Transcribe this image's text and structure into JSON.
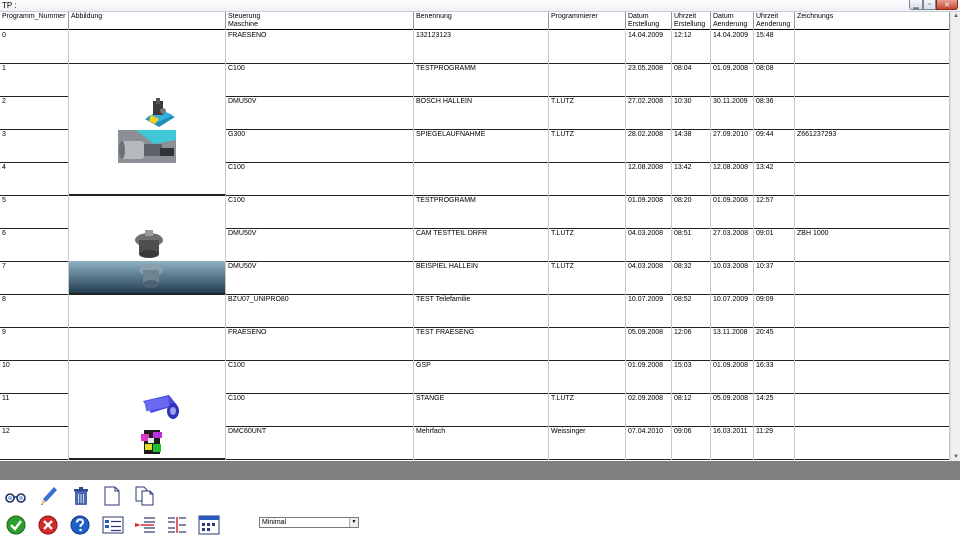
{
  "window": {
    "title": "TP :"
  },
  "columns": [
    "Programm_Nummer",
    "Abbildung",
    "Steuerung\nMaschine",
    "Benennung",
    "Programmierer",
    "Datum\nErstellung",
    "Uhrzeit\nErstellung",
    "Datum\nAenderung",
    "Uhrzeit\nAenderung",
    "Zeichnungs"
  ],
  "rows": [
    [
      "0",
      "FRAESENO",
      "132123123",
      "",
      "14.04.2009",
      "12:12",
      "14.04.2009",
      "15:48",
      ""
    ],
    [
      "1",
      "C100",
      "TESTPROGRAMM",
      "",
      "23.05.2008",
      "08:04",
      "01.09.2008",
      "08:08",
      ""
    ],
    [
      "2",
      "DMU50V",
      "BOSCH HALLEIN",
      "T.LUTZ",
      "27.02.2008",
      "10:30",
      "30.11.2009",
      "08:36",
      ""
    ],
    [
      "3",
      "G300",
      "SPIEGELAUFNAHME",
      "T.LUTZ",
      "28.02.2008",
      "14:38",
      "27.09.2010",
      "09:44",
      "Z661237293"
    ],
    [
      "4",
      "C100",
      "",
      "",
      "12.08.2008",
      "13:42",
      "12.08.2008",
      "13:42",
      ""
    ],
    [
      "5",
      "C100",
      "TESTPROGRAMM",
      "",
      "01.09.2008",
      "08:20",
      "01.09.2008",
      "12:57",
      ""
    ],
    [
      "6",
      "DMU50V",
      "CAM TESTTEIL DRFR",
      "T.LUTZ",
      "04.03.2008",
      "08:51",
      "27.03.2008",
      "09:01",
      "ZBH 1000"
    ],
    [
      "7",
      "DMU50V",
      "BEISPIEL HALLEIN",
      "T.LUTZ",
      "04.03.2008",
      "08:32",
      "10.03.2008",
      "10:37",
      ""
    ],
    [
      "8",
      "BZU07_UNIPRO80",
      "TEST Teilefamilie",
      "",
      "10.07.2009",
      "08:52",
      "10.07.2009",
      "09:09",
      ""
    ],
    [
      "9",
      "FRAESENO",
      "TEST FRAESENG",
      "",
      "05.09.2008",
      "12:06",
      "13.11.2008",
      "20:45",
      ""
    ],
    [
      "10",
      "C100",
      "GSP",
      "",
      "01.09.2008",
      "15:03",
      "01.09.2008",
      "16:33",
      ""
    ],
    [
      "11",
      "C100",
      "STANGE",
      "T.LUTZ",
      "02.09.2008",
      "08:12",
      "05.09.2008",
      "14:25",
      ""
    ],
    [
      "12",
      "DMC60UNT",
      "Mehrfach",
      "Weissinger",
      "07.04.2010",
      "09:06",
      "16.03.2011",
      "11:29",
      ""
    ]
  ],
  "icons": {
    "toolbar_row1": [
      "glasses-view-icon",
      "pencil-edit-icon",
      "trash-delete-icon",
      "new-document-icon",
      "copy-document-icon"
    ],
    "toolbar_row2": [
      "ok-check-icon",
      "cancel-x-icon",
      "help-question-icon",
      "list-view-icon",
      "insert-row-icon",
      "move-row-icon",
      "calendar-window-icon"
    ]
  },
  "view_select": {
    "value": "Minimal"
  },
  "colors": {
    "gray_band": "#808080",
    "ok": "#2e9e2e",
    "cancel": "#d32a2a",
    "help": "#1e5fc8"
  }
}
